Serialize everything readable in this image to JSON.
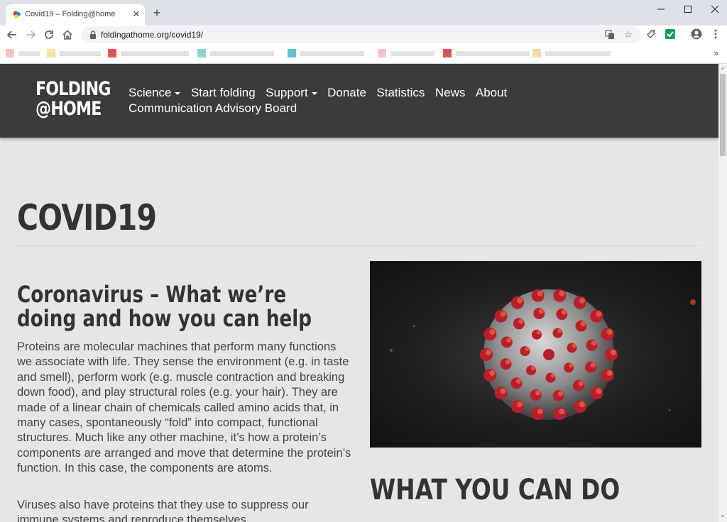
{
  "browser": {
    "tab_title": "Covid19 – Folding@home",
    "url": "foldingathome.org/covid19/",
    "bookmarks_more": "»"
  },
  "site": {
    "logo_line1": "FOLDING",
    "logo_line2": "@HOME",
    "nav": {
      "science": "Science",
      "start_folding": "Start folding",
      "support": "Support",
      "donate": "Donate",
      "statistics": "Statistics",
      "news": "News",
      "about": "About",
      "communication_board": "Communication Advisory Board"
    }
  },
  "content": {
    "page_title": "COVID19",
    "subheading": "Coronavirus – What we’re doing and how you can help",
    "paragraph1": "Proteins are molecular machines that perform many functions we associate with life. They sense the environment (e.g. in taste and smell), perform work (e.g. muscle contraction and breaking down food), and play structural roles (e.g. your hair). They are made of a linear chain of chemicals called amino acids that, in many cases, spontaneously “fold” into compact, functional structures. Much like any other machine, it’s how a protein’s components are arranged and move that determine the protein’s function. In this case, the components are atoms.",
    "paragraph2": "Viruses also have proteins that they use to suppress our immune systems and reproduce themselves.",
    "section_heading": "WHAT YOU CAN DO"
  },
  "colors": {
    "header_bg": "#3b3b3b",
    "page_bg": "#e6e6e6",
    "text_dark": "#333333",
    "virus_spike": "#b81f2a"
  }
}
